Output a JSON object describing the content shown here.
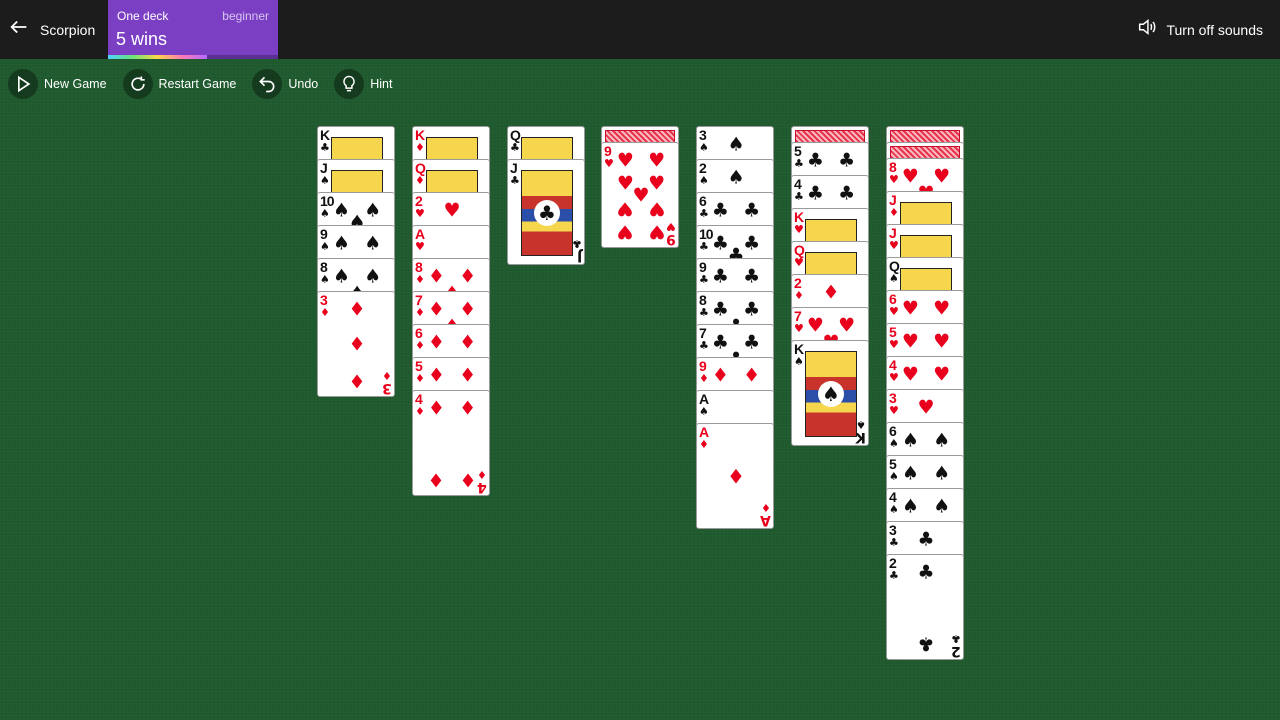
{
  "header": {
    "back_label": "Scorpion",
    "deck_mode": "One deck",
    "difficulty": "beginner",
    "wins_text": "5 wins",
    "progress_fraction": 0.58,
    "sound_label": "Turn off sounds"
  },
  "toolbar": {
    "new_game": "New Game",
    "restart_game": "Restart Game",
    "undo": "Undo",
    "hint": "Hint"
  },
  "colors": {
    "felt": "#1f5a2e",
    "topbar": "#1c1c1c",
    "badge": "#7b3fc4",
    "red_suit": "#e8001c",
    "black_suit": "#111111"
  },
  "tableau": [
    {
      "column": 1,
      "cards": [
        {
          "rank": "K",
          "suit": "clubs",
          "face_up": true
        },
        {
          "rank": "J",
          "suit": "spades",
          "face_up": true
        },
        {
          "rank": "10",
          "suit": "spades",
          "face_up": true
        },
        {
          "rank": "9",
          "suit": "spades",
          "face_up": true
        },
        {
          "rank": "8",
          "suit": "spades",
          "face_up": true
        },
        {
          "rank": "3",
          "suit": "diamonds",
          "face_up": true
        }
      ]
    },
    {
      "column": 2,
      "cards": [
        {
          "rank": "K",
          "suit": "diamonds",
          "face_up": true
        },
        {
          "rank": "Q",
          "suit": "diamonds",
          "face_up": true
        },
        {
          "rank": "2",
          "suit": "hearts",
          "face_up": true
        },
        {
          "rank": "A",
          "suit": "hearts",
          "face_up": true
        },
        {
          "rank": "8",
          "suit": "diamonds",
          "face_up": true
        },
        {
          "rank": "7",
          "suit": "diamonds",
          "face_up": true
        },
        {
          "rank": "6",
          "suit": "diamonds",
          "face_up": true
        },
        {
          "rank": "5",
          "suit": "diamonds",
          "face_up": true
        },
        {
          "rank": "4",
          "suit": "diamonds",
          "face_up": true
        }
      ]
    },
    {
      "column": 3,
      "cards": [
        {
          "rank": "Q",
          "suit": "clubs",
          "face_up": true
        },
        {
          "rank": "J",
          "suit": "clubs",
          "face_up": true
        }
      ]
    },
    {
      "column": 4,
      "cards": [
        {
          "rank": "",
          "suit": "",
          "face_up": false
        },
        {
          "rank": "9",
          "suit": "hearts",
          "face_up": true
        }
      ]
    },
    {
      "column": 5,
      "cards": [
        {
          "rank": "3",
          "suit": "spades",
          "face_up": true
        },
        {
          "rank": "2",
          "suit": "spades",
          "face_up": true
        },
        {
          "rank": "6",
          "suit": "clubs",
          "face_up": true
        },
        {
          "rank": "10",
          "suit": "clubs",
          "face_up": true
        },
        {
          "rank": "9",
          "suit": "clubs",
          "face_up": true
        },
        {
          "rank": "8",
          "suit": "clubs",
          "face_up": true
        },
        {
          "rank": "7",
          "suit": "clubs",
          "face_up": true
        },
        {
          "rank": "9",
          "suit": "diamonds",
          "face_up": true
        },
        {
          "rank": "A",
          "suit": "spades",
          "face_up": true
        },
        {
          "rank": "A",
          "suit": "diamonds",
          "face_up": true
        }
      ]
    },
    {
      "column": 6,
      "cards": [
        {
          "rank": "",
          "suit": "",
          "face_up": false
        },
        {
          "rank": "5",
          "suit": "clubs",
          "face_up": true
        },
        {
          "rank": "4",
          "suit": "clubs",
          "face_up": true
        },
        {
          "rank": "K",
          "suit": "hearts",
          "face_up": true
        },
        {
          "rank": "Q",
          "suit": "hearts",
          "face_up": true
        },
        {
          "rank": "2",
          "suit": "diamonds",
          "face_up": true
        },
        {
          "rank": "7",
          "suit": "hearts",
          "face_up": true
        },
        {
          "rank": "K",
          "suit": "spades",
          "face_up": true
        }
      ]
    },
    {
      "column": 7,
      "cards": [
        {
          "rank": "",
          "suit": "",
          "face_up": false
        },
        {
          "rank": "",
          "suit": "",
          "face_up": false
        },
        {
          "rank": "8",
          "suit": "hearts",
          "face_up": true
        },
        {
          "rank": "J",
          "suit": "diamonds",
          "face_up": true
        },
        {
          "rank": "J",
          "suit": "hearts",
          "face_up": true
        },
        {
          "rank": "Q",
          "suit": "spades",
          "face_up": true
        },
        {
          "rank": "6",
          "suit": "hearts",
          "face_up": true
        },
        {
          "rank": "5",
          "suit": "hearts",
          "face_up": true
        },
        {
          "rank": "4",
          "suit": "hearts",
          "face_up": true
        },
        {
          "rank": "3",
          "suit": "hearts",
          "face_up": true
        },
        {
          "rank": "6",
          "suit": "spades",
          "face_up": true
        },
        {
          "rank": "5",
          "suit": "spades",
          "face_up": true
        },
        {
          "rank": "4",
          "suit": "spades",
          "face_up": true
        },
        {
          "rank": "3",
          "suit": "clubs",
          "face_up": true
        },
        {
          "rank": "2",
          "suit": "clubs",
          "face_up": true
        }
      ]
    }
  ]
}
